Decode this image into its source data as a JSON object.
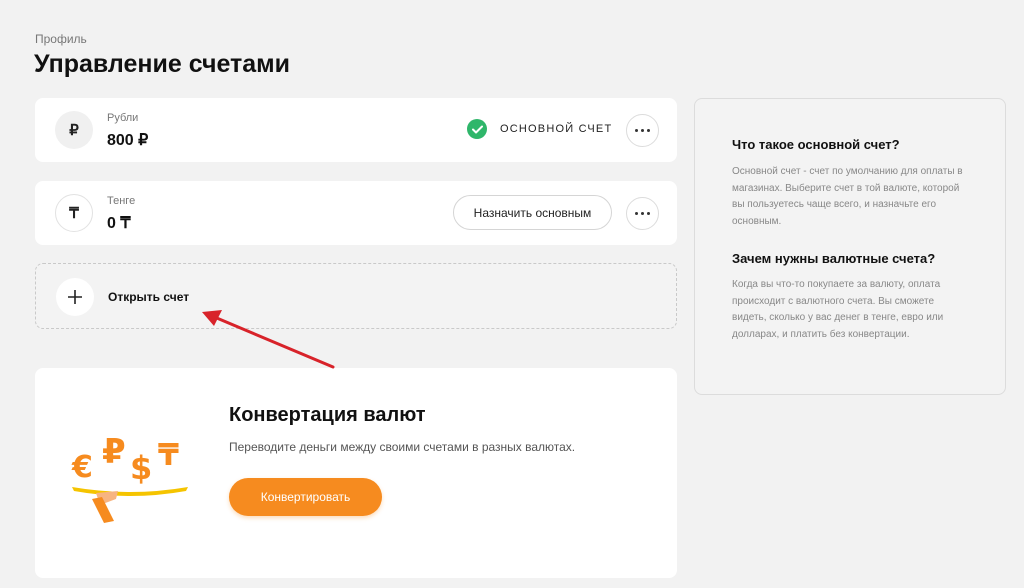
{
  "breadcrumb": "Профиль",
  "page_title": "Управление счетами",
  "accounts": [
    {
      "currency_symbol": "₽",
      "name": "Рубли",
      "balance": "800 ₽",
      "main_label": "ОСНОВНОЙ СЧЕТ",
      "is_main": true
    },
    {
      "currency_symbol": "₸",
      "name": "Тенге",
      "balance": "0 ₸",
      "set_main_label": "Назначить основным",
      "is_main": false
    }
  ],
  "open_account": {
    "icon": "plus-icon",
    "label": "Открыть счет"
  },
  "convert": {
    "title": "Конвертация валют",
    "description": "Переводите деньги между своими счетами в разных валютах.",
    "button_label": "Конвертировать",
    "illustration_symbols": [
      "€",
      "₽",
      "$",
      "₸"
    ]
  },
  "info": {
    "q1_title": "Что такое основной счет?",
    "q1_text": "Основной счет - счет по умолчанию для оплаты в магазинах. Выберите счет в той валюте, которой вы пользуетесь чаще всего, и назначьте его основным.",
    "q2_title": "Зачем нужны валютные счета?",
    "q2_text": "Когда вы что-то покупаете за валюту, оплата происходит с валютного счета. Вы сможете видеть, сколько у вас денег в тенге, евро или долларах, и платить без конвертации."
  },
  "colors": {
    "accent": "#f68b1f",
    "success": "#2fb66a",
    "annotation_arrow": "#d8232a"
  }
}
